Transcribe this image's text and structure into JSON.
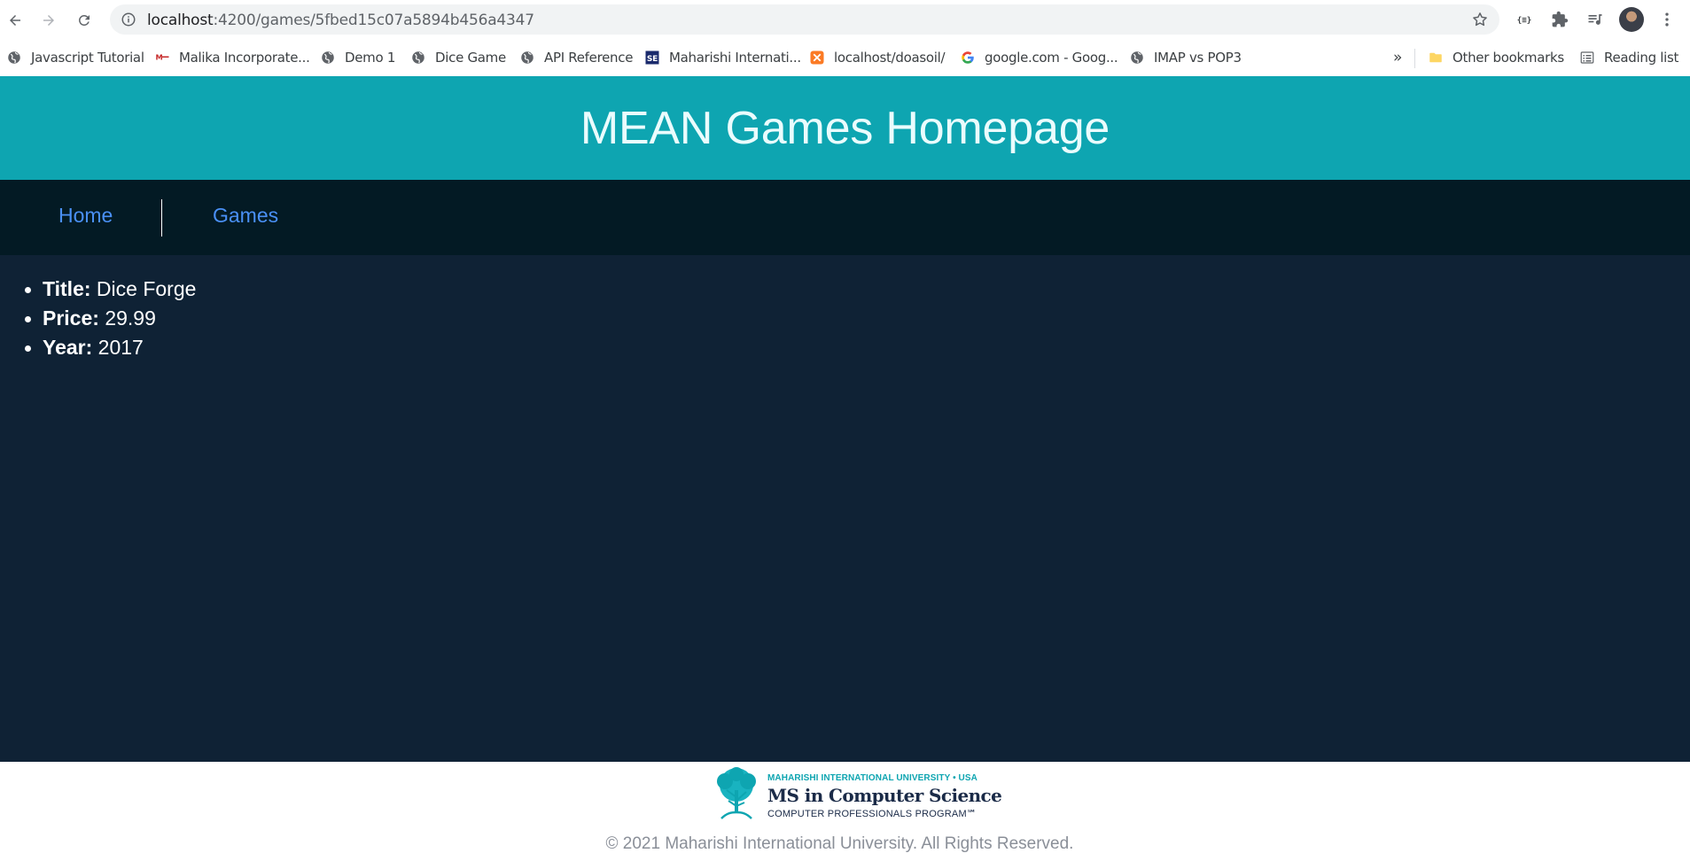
{
  "browser": {
    "url_host": "localhost",
    "url_path": ":4200/games/5fbed15c07a5894b456a4347",
    "bookmarks": [
      {
        "label": "Javascript Tutorial",
        "icon": "globe-icon"
      },
      {
        "label": "Malika Incorporate...",
        "icon": "malika-logo-icon"
      },
      {
        "label": "Demo 1",
        "icon": "globe-icon"
      },
      {
        "label": "Dice Game",
        "icon": "globe-icon"
      },
      {
        "label": "API Reference",
        "icon": "globe-icon"
      },
      {
        "label": "Maharishi Internati...",
        "icon": "se-logo-icon"
      },
      {
        "label": "localhost/doasoil/",
        "icon": "xampp-icon"
      },
      {
        "label": "google.com - Goog...",
        "icon": "google-icon"
      },
      {
        "label": "IMAP vs POP3",
        "icon": "globe-icon"
      }
    ],
    "overflow_label": "»",
    "other_bookmarks": "Other bookmarks",
    "reading_list": "Reading list"
  },
  "header": {
    "title": "MEAN Games Homepage"
  },
  "nav": {
    "home": "Home",
    "games": "Games"
  },
  "game": {
    "title_label": "Title:",
    "title": "Dice Forge",
    "price_label": "Price:",
    "price": "29.99",
    "year_label": "Year:",
    "year": "2017"
  },
  "footer": {
    "logo_line1": "MAHARISHI INTERNATIONAL UNIVERSITY • USA",
    "logo_line2": "MS in Computer Science",
    "logo_line3": "COMPUTER PROFESSIONALS PROGRAM℠",
    "copyright": "© 2021 Maharishi International University. All Rights Reserved."
  },
  "colors": {
    "header_bg": "#0ea5b1",
    "nav_bg": "#031a24",
    "content_bg": "#0f2235",
    "link": "#4a90f5"
  }
}
